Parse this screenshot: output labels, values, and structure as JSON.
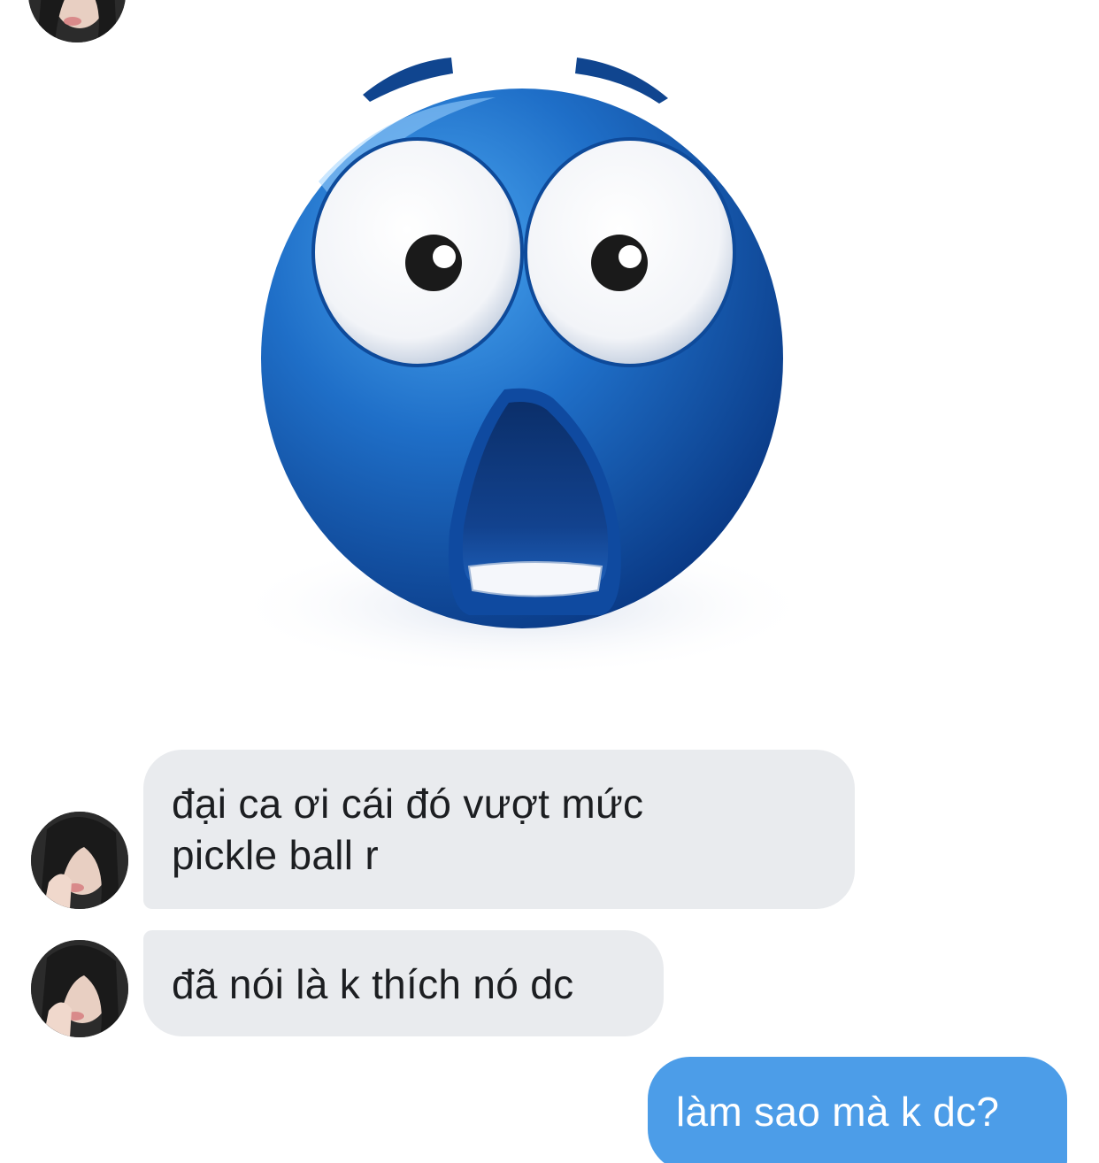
{
  "conversation": {
    "sticker": {
      "icon": "shocked-blue-face-sticker",
      "colors": {
        "face": "#1f6fc8",
        "face_dark": "#0d3f8a",
        "eye_white": "#ffffff",
        "pupil": "#1a1a1a"
      }
    },
    "messages": [
      {
        "sender": "contact",
        "text": "đại ca ơi cái đó vượt mức\npickle ball r"
      },
      {
        "sender": "contact",
        "text": "đã nói là k thích nó dc"
      },
      {
        "sender": "me",
        "text": "làm sao mà k dc?"
      }
    ],
    "colors": {
      "incoming_bubble": "#e9ebee",
      "outgoing_bubble": "#4c9de8",
      "incoming_text": "#1c1e21",
      "outgoing_text": "#ffffff"
    }
  }
}
